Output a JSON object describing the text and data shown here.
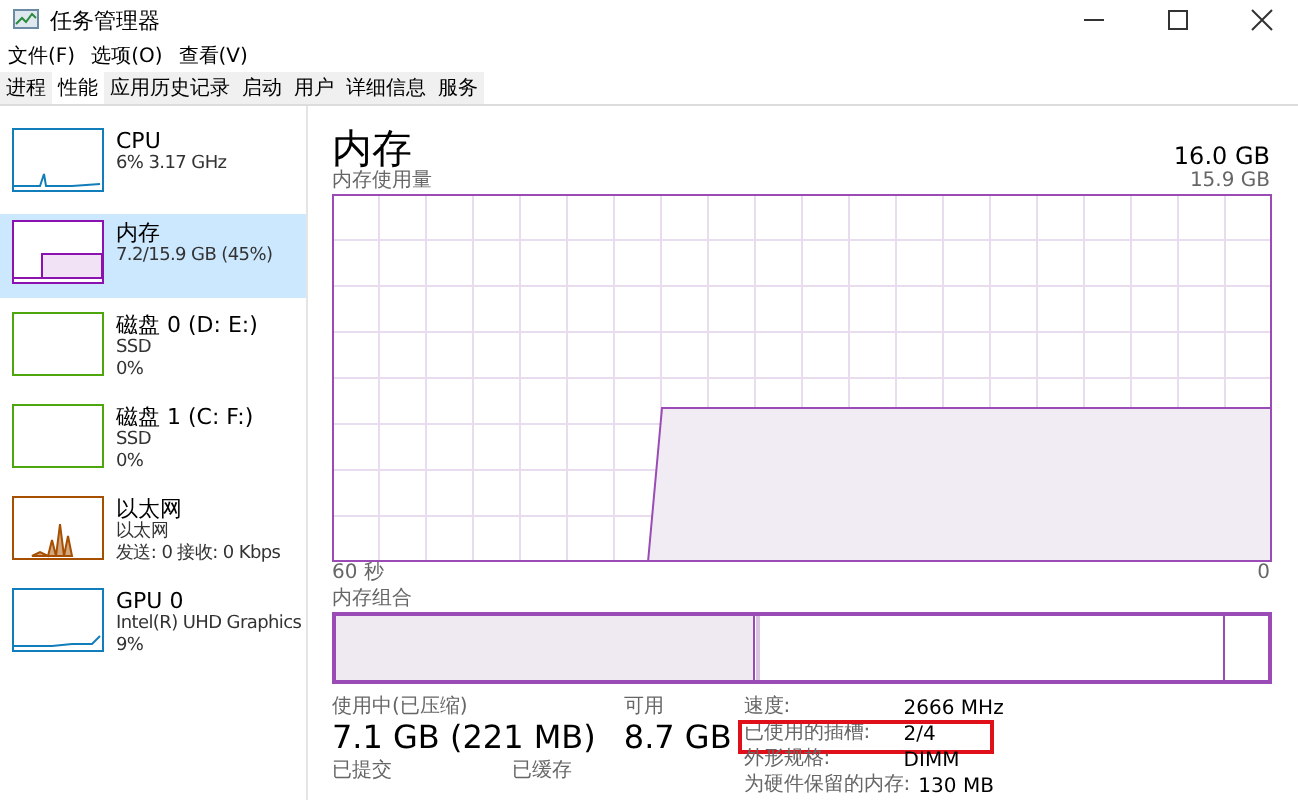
{
  "window": {
    "title": "任务管理器"
  },
  "menu": [
    "文件(F)",
    "选项(O)",
    "查看(V)"
  ],
  "tabs": [
    {
      "label": "进程",
      "selected": false
    },
    {
      "label": "性能",
      "selected": true
    },
    {
      "label": "应用历史记录",
      "selected": false
    },
    {
      "label": "启动",
      "selected": false
    },
    {
      "label": "用户",
      "selected": false
    },
    {
      "label": "详细信息",
      "selected": false
    },
    {
      "label": "服务",
      "selected": false
    }
  ],
  "sidebar": {
    "items": [
      {
        "kind": "cpu",
        "color": "#117dbb",
        "name": "CPU",
        "lines": [
          "6% 3.17 GHz"
        ],
        "selected": false
      },
      {
        "kind": "memory",
        "color": "#8b12ae",
        "name": "内存",
        "lines": [
          "7.2/15.9 GB (45%)"
        ],
        "selected": true
      },
      {
        "kind": "disk",
        "color": "#4da60c",
        "name": "磁盘 0 (D: E:)",
        "lines": [
          "SSD",
          "0%"
        ],
        "selected": false
      },
      {
        "kind": "disk",
        "color": "#4da60c",
        "name": "磁盘 1 (C: F:)",
        "lines": [
          "SSD",
          "0%"
        ],
        "selected": false
      },
      {
        "kind": "network",
        "color": "#a74f01",
        "name": "以太网",
        "lines": [
          "以太网",
          "发送: 0 接收: 0 Kbps"
        ],
        "selected": false
      },
      {
        "kind": "gpu",
        "color": "#117dbb",
        "name": "GPU 0",
        "lines": [
          "Intel(R) UHD Graphics",
          "9%"
        ],
        "selected": false
      }
    ]
  },
  "main": {
    "title": "内存",
    "total": "16.0 GB",
    "usage_label": "内存使用量",
    "usage_max": "15.9 GB",
    "time_start": "60 秒",
    "time_end": "0",
    "composition_label": "内存组合",
    "stats": [
      {
        "label": "使用中(已压缩)",
        "value": "7.1 GB (221 MB)"
      },
      {
        "label": "可用",
        "value": "8.7 GB"
      }
    ],
    "stats_lower": [
      "已提交",
      "已缓存"
    ],
    "details": [
      {
        "label": "速度:",
        "value": "2666 MHz",
        "highlighted": false
      },
      {
        "label": "已使用的插槽:",
        "value": "2/4",
        "highlighted": true
      },
      {
        "label": "外形规格:",
        "value": "DIMM",
        "highlighted": false
      },
      {
        "label": "为硬件保留的内存:",
        "value": "130 MB",
        "highlighted": false
      }
    ]
  }
}
